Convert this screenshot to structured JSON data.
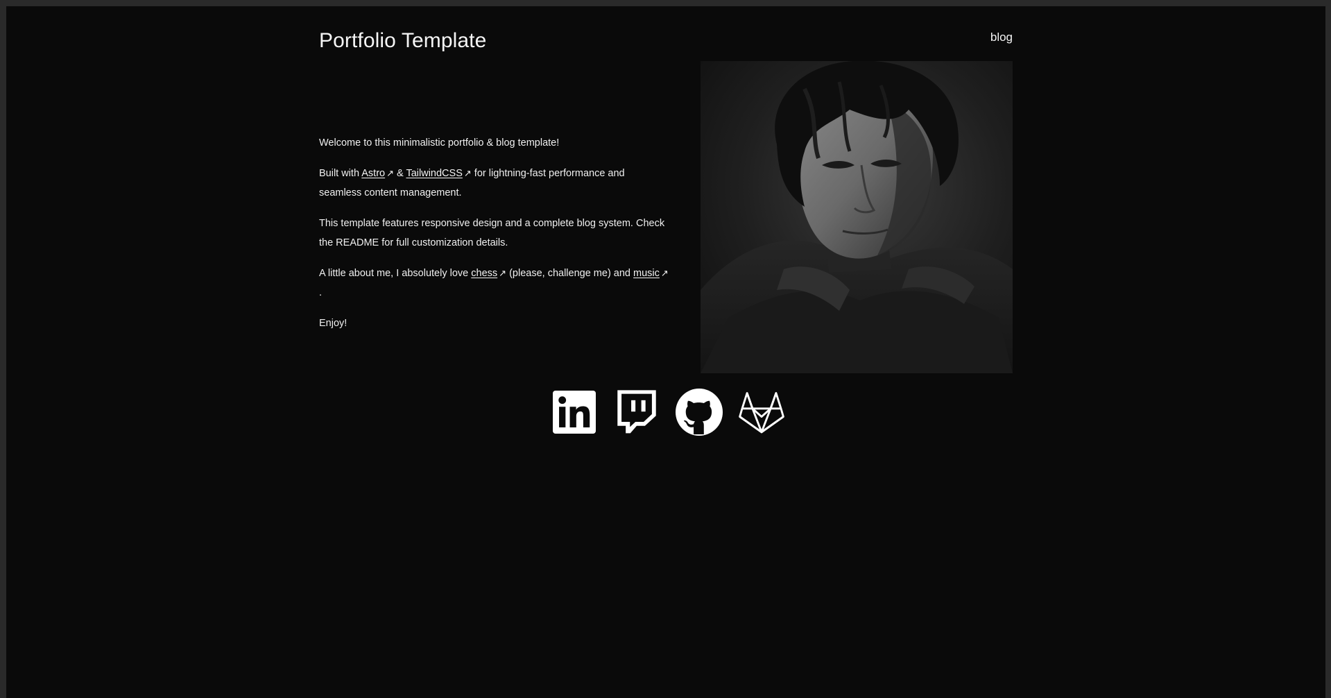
{
  "site": {
    "title": "Portfolio Template"
  },
  "nav": {
    "blog_label": "blog"
  },
  "intro": {
    "welcome": "Welcome to this minimalistic portfolio & blog template!",
    "built_prefix": "Built with ",
    "astro_label": "Astro",
    "and": " & ",
    "tailwind_label": "TailwindCSS",
    "built_suffix": " for lightning-fast performance and seamless content management.",
    "features": "This template features responsive design and a complete blog system. Check the README for full customization details.",
    "about_prefix": "A little about me, I absolutely love ",
    "chess_label": "chess",
    "about_middle": " (please, challenge me) and ",
    "music_label": "music",
    "about_suffix": ".",
    "enjoy": "Enjoy!",
    "external_arrow": "↗"
  },
  "socials": [
    {
      "name": "linkedin",
      "icon": "linkedin-icon"
    },
    {
      "name": "twitch",
      "icon": "twitch-icon"
    },
    {
      "name": "github",
      "icon": "github-icon"
    },
    {
      "name": "gitlab",
      "icon": "gitlab-icon"
    }
  ],
  "colors": {
    "background": "#0a0a0a",
    "text": "#f0f0f0",
    "outer_frame": "#2a2a2a"
  }
}
